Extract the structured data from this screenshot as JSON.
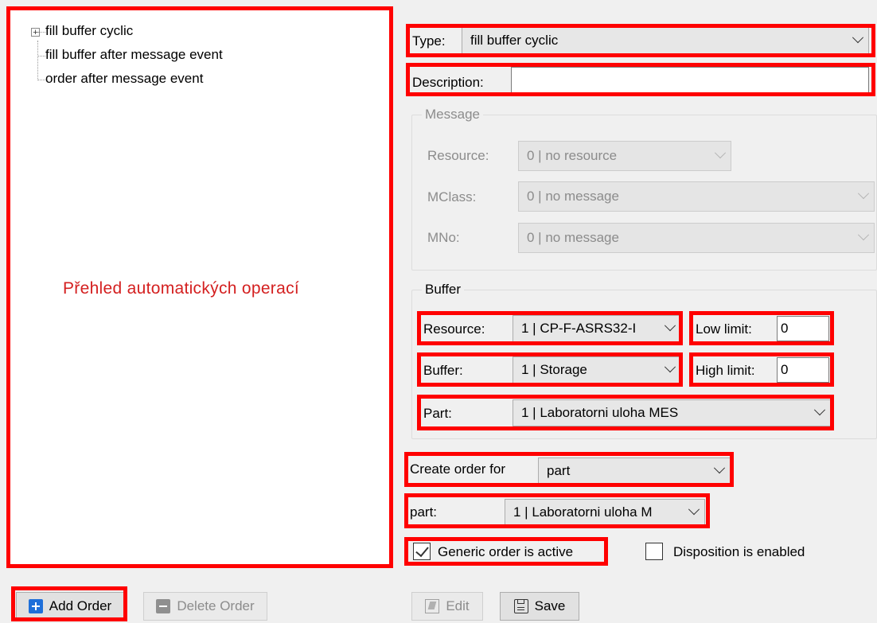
{
  "tree": {
    "items": [
      "fill buffer cyclic",
      "fill buffer after message event",
      "order after message event"
    ],
    "overlay_label": "Přehled automatických operací"
  },
  "form": {
    "type_label": "Type:",
    "type_value": "fill buffer cyclic",
    "description_label": "Description:",
    "description_value": "",
    "message_group": "Message",
    "msg_resource_label": "Resource:",
    "msg_resource_value": "0 | no resource",
    "mclass_label": "MClass:",
    "mclass_value": "0 | no message",
    "mno_label": "MNo:",
    "mno_value": "0 | no message",
    "buffer_group": "Buffer",
    "resource_label": "Resource:",
    "resource_value": "1 | CP-F-ASRS32-I",
    "buffer_label": "Buffer:",
    "buffer_value": "1 | Storage",
    "part_label": "Part:",
    "part_value": "1 | Laboratorni uloha MES",
    "low_limit_label": "Low limit:",
    "low_limit_value": "0",
    "high_limit_label": "High limit:",
    "high_limit_value": "0",
    "create_order_label": "Create order for",
    "create_order_value": "part",
    "part2_label": "part:",
    "part2_value": "1 | Laboratorni uloha M",
    "generic_label": "Generic order is active",
    "generic_checked": true,
    "disposition_label": "Disposition is enabled",
    "disposition_checked": false
  },
  "buttons": {
    "add_order": "Add Order",
    "delete_order": "Delete Order",
    "edit": "Edit",
    "save": "Save"
  },
  "colors": {
    "highlight": "#ff0000",
    "overlay_text": "#d42020",
    "add_icon": "#1e6fd9"
  }
}
